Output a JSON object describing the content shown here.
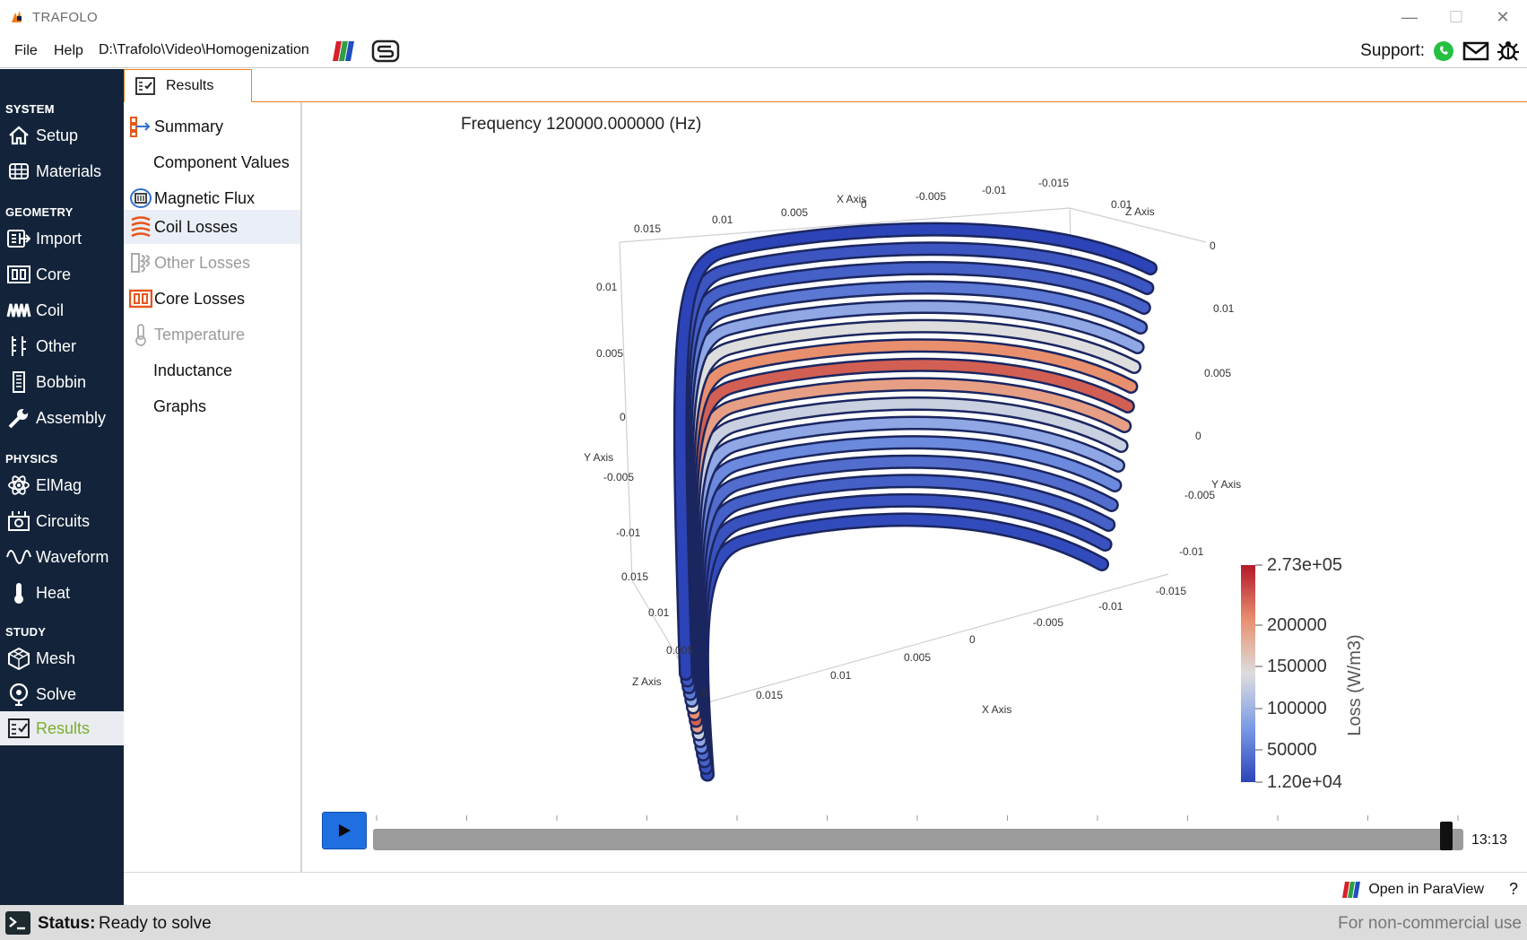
{
  "window": {
    "title": "TRAFOLO",
    "minimize": "—",
    "maximize": "☐",
    "close": "✕"
  },
  "menubar": {
    "file": "File",
    "help": "Help",
    "project_path": "D:\\Trafolo\\Video\\Homogenization",
    "support_label": "Support:"
  },
  "sidebar": {
    "sections": {
      "system": "SYSTEM",
      "geometry": "GEOMETRY",
      "physics": "PHYSICS",
      "study": "STUDY"
    },
    "items": {
      "setup": "Setup",
      "materials": "Materials",
      "import": "Import",
      "core": "Core",
      "coil": "Coil",
      "other": "Other",
      "bobbin": "Bobbin",
      "assembly": "Assembly",
      "elmag": "ElMag",
      "circuits": "Circuits",
      "waveform": "Waveform",
      "heat": "Heat",
      "mesh": "Mesh",
      "solve": "Solve",
      "results": "Results"
    }
  },
  "tabs": {
    "results": "Results"
  },
  "results_nav": {
    "summary": "Summary",
    "component_values": "Component Values",
    "magnetic_flux": "Magnetic Flux",
    "coil_losses": "Coil Losses",
    "other_losses": "Other Losses",
    "core_losses": "Core Losses",
    "temperature": "Temperature",
    "inductance": "Inductance",
    "graphs": "Graphs"
  },
  "viewer": {
    "frequency_title": "Frequency 120000.000000 (Hz)",
    "axes": {
      "x_axis_top": "X Axis",
      "z_axis_top": "Z Axis",
      "y_axis_left": "Y Axis",
      "y_axis_right": "Y Axis",
      "z_axis_bottom": "Z Axis",
      "x_axis_bottom": "X Axis",
      "top_x_ticks": [
        "0.015",
        "0.01",
        "0.005",
        "0",
        "-0.005",
        "-0.01",
        "-0.015"
      ],
      "top_z_ticks": [
        "0.01",
        "0"
      ],
      "left_y_ticks": [
        "0.01",
        "0.005",
        "0",
        "-0.005",
        "-0.01"
      ],
      "right_y_ticks": [
        "0.01",
        "0.005",
        "0",
        "-0.005",
        "-0.01",
        "-0.015"
      ],
      "bottom_z_ticks": [
        "0.015",
        "0.01",
        "0.005",
        "0"
      ],
      "bottom_x_ticks": [
        "0.015",
        "0.01",
        "0.005",
        "0",
        "-0.005",
        "-0.01"
      ]
    },
    "colorbar": {
      "title": "Loss (W/m3)",
      "labels": [
        "2.73e+05",
        "200000",
        "150000",
        "100000",
        "50000",
        "1.20e+04"
      ],
      "colors": {
        "high": "#b2182b",
        "mid": "#dddddd",
        "low": "#2c44b8"
      }
    }
  },
  "playback": {
    "time": "13:13",
    "progress": 0.99
  },
  "bottombar": {
    "open_paraview": "Open in ParaView",
    "help": "?"
  },
  "statusbar": {
    "label": "Status:",
    "value": "Ready to solve",
    "license": "For non-commercial use"
  },
  "icons": {
    "app": "trafolo-logo-icon",
    "paraview": "paraview-icon",
    "simulation": "s-logo-icon",
    "whatsapp": "whatsapp-icon",
    "mail": "mail-icon",
    "bug": "bug-icon"
  }
}
